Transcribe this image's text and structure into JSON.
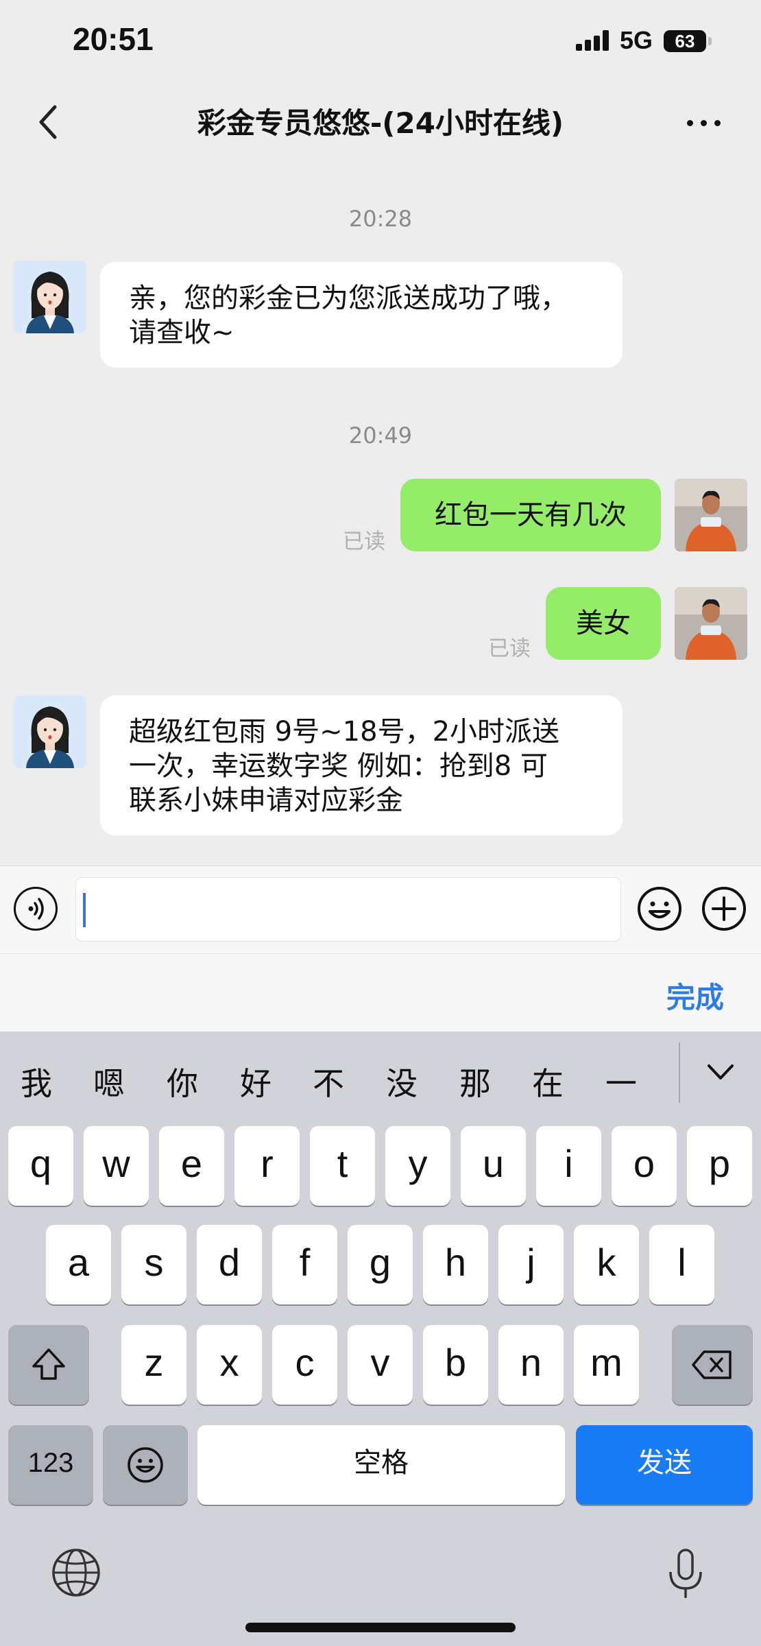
{
  "status_bar": {
    "time": "20:51",
    "network": "5G",
    "battery": "63"
  },
  "nav": {
    "title": "彩金专员悠悠-(24小时在线)"
  },
  "messages": [
    {
      "type": "timestamp",
      "text": "20:28"
    },
    {
      "type": "incoming",
      "text_line1": "亲，您的彩金已为您派送成功了哦，",
      "text_line2": "请查收~"
    },
    {
      "type": "timestamp",
      "text": "20:49"
    },
    {
      "type": "outgoing",
      "text": "红包一天有几次",
      "status": "已读"
    },
    {
      "type": "outgoing",
      "text": "美女",
      "status": "已读"
    },
    {
      "type": "incoming",
      "text_line1": "超级红包雨 9号~18号，2小时派送",
      "text_line2": "一次，幸运数字奖 例如：抢到8  可",
      "text_line3": "联系小妹申请对应彩金"
    }
  ],
  "input": {
    "value": ""
  },
  "done_label": "完成",
  "keyboard": {
    "candidates": [
      "我",
      "嗯",
      "你",
      "好",
      "不",
      "没",
      "那",
      "在",
      "一"
    ],
    "row1": [
      "q",
      "w",
      "e",
      "r",
      "t",
      "y",
      "u",
      "i",
      "o",
      "p"
    ],
    "row2": [
      "a",
      "s",
      "d",
      "f",
      "g",
      "h",
      "j",
      "k",
      "l"
    ],
    "row3": [
      "z",
      "x",
      "c",
      "v",
      "b",
      "n",
      "m"
    ],
    "numbers_label": "123",
    "space_label": "空格",
    "send_label": "发送"
  },
  "colors": {
    "outgoing_bubble": "#95ec69",
    "accent": "#1a7cf5",
    "done": "#2f7be5"
  }
}
